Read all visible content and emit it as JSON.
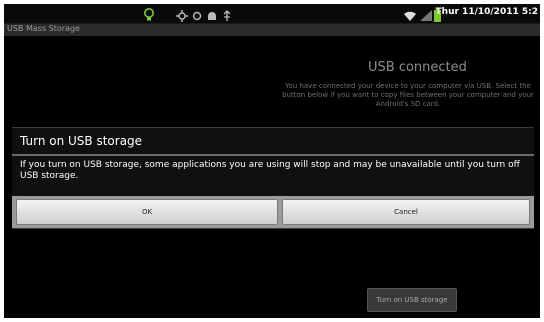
{
  "status_bar": {
    "clock": "Thur 11/10/2011 5:2",
    "icons": [
      "lightbulb-notification-icon",
      "usb-icon",
      "settings-icon",
      "android-debug-icon",
      "usb-debug-icon",
      "wifi-icon",
      "signal-icon",
      "battery-icon"
    ],
    "accent_color": "#7ccc2e"
  },
  "titlebar": {
    "title": "USB Mass Storage"
  },
  "background": {
    "heading": "USB connected",
    "description": "You have connected your device to your computer via USB. Select the button below if you want to copy files between your computer and your Android's SD card.",
    "button_label": "Turn on USB storage"
  },
  "dialog": {
    "title": "Turn on USB storage",
    "message": "If you turn on USB storage, some applications you are using will stop and may be unavailable until you turn off USB storage.",
    "ok_label": "OK",
    "cancel_label": "Cancel"
  }
}
